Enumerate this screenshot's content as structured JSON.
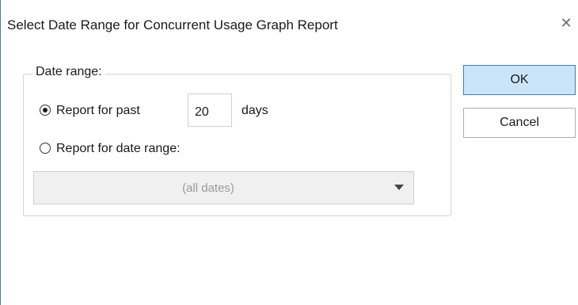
{
  "window": {
    "title": "Select Date Range for Concurrent Usage Graph Report",
    "close_glyph": "✕"
  },
  "group": {
    "legend": "Date range:",
    "option_past": {
      "label": "Report for past",
      "checked": true,
      "days_value": "20",
      "days_unit": "days"
    },
    "option_range": {
      "label": "Report for date range:",
      "checked": false
    },
    "date_dropdown": {
      "selected": "(all dates)"
    }
  },
  "buttons": {
    "ok_label": "OK",
    "cancel_label": "Cancel"
  },
  "colors": {
    "accent": "#3c7fb1",
    "ok_fill": "#cce4f7",
    "disabled_text": "#9a9a9a"
  }
}
